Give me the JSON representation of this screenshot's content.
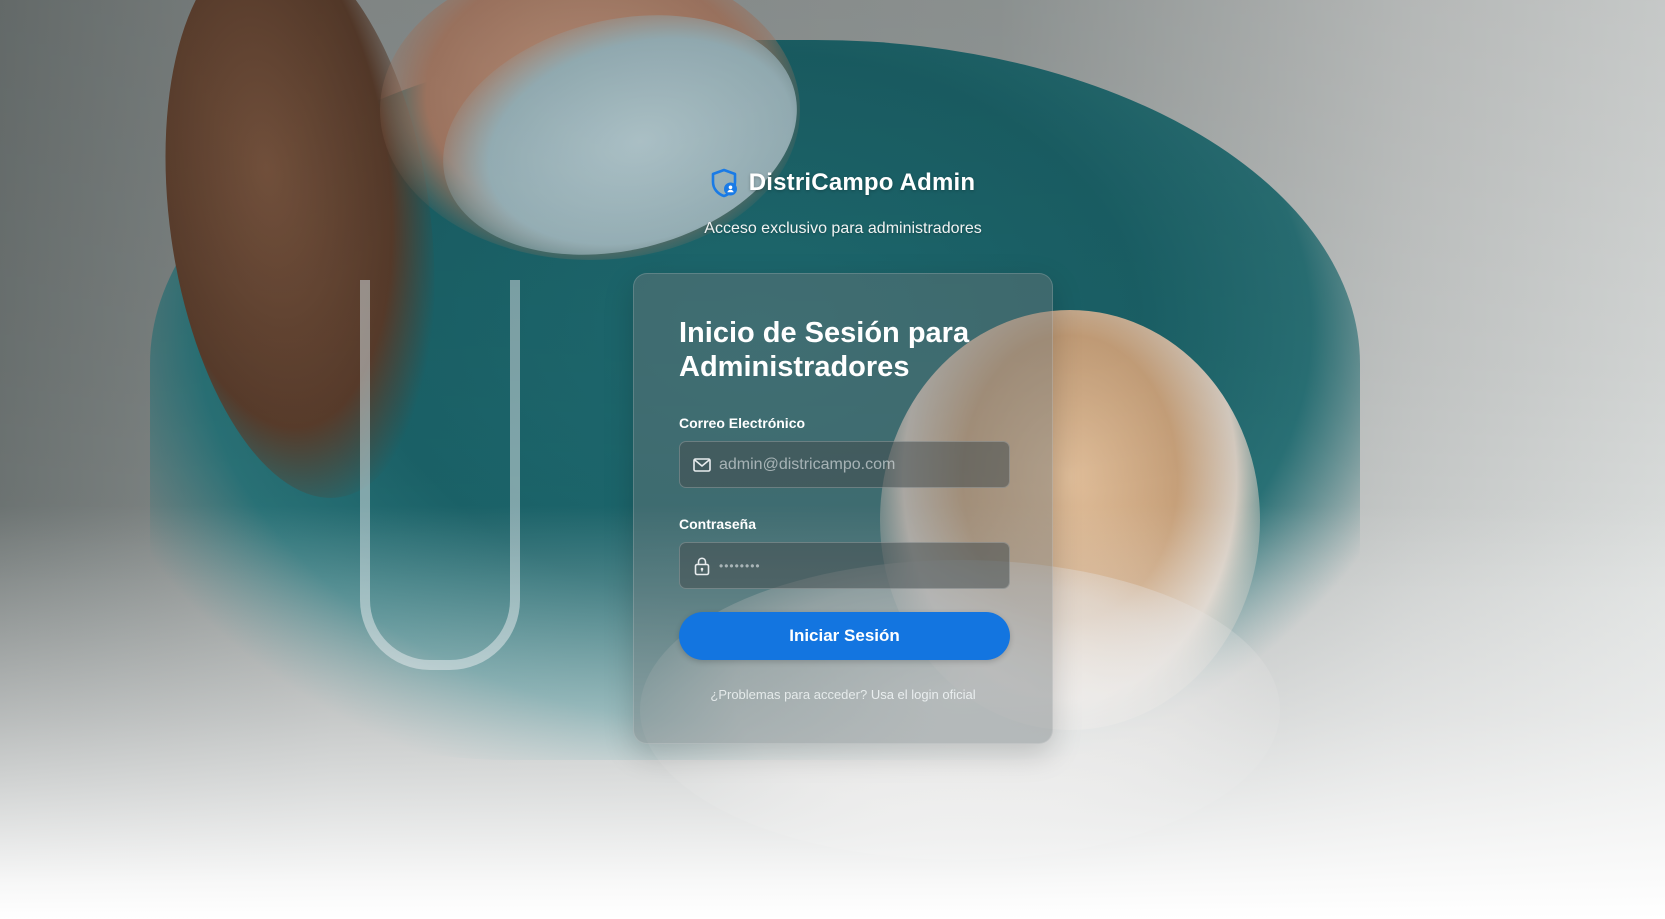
{
  "brand": {
    "title": "DistriCampo Admin",
    "icon": "shield-user-icon",
    "accent_color": "#1375e0"
  },
  "subtitle": "Acceso exclusivo para administradores",
  "login_card": {
    "title": "Inicio de Sesión para Administradores",
    "email": {
      "label": "Correo Electrónico",
      "placeholder": "admin@districampo.com",
      "value": "",
      "icon": "envelope-icon"
    },
    "password": {
      "label": "Contraseña",
      "placeholder": "••••••••",
      "value": "",
      "icon": "lock-icon"
    },
    "submit_label": "Iniciar Sesión",
    "help": {
      "text": "¿Problemas para acceder?",
      "link_text": "Usa el login oficial"
    }
  },
  "background": {
    "description_icon": "veterinarian-with-dog-photo"
  }
}
